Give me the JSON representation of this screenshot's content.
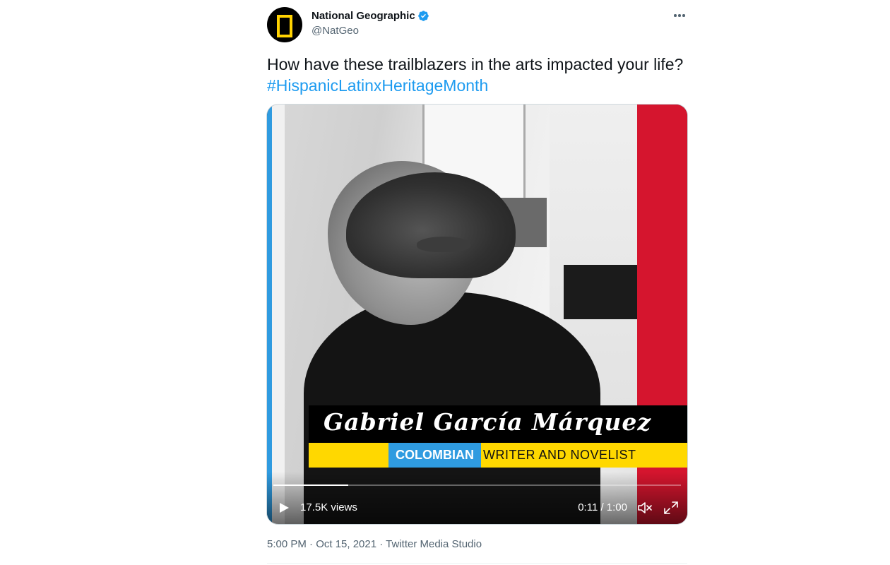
{
  "author": {
    "name": "National Geographic",
    "handle": "@NatGeo",
    "verified": true,
    "avatar_icon": "natgeo-yellow-frame-logo"
  },
  "tweet": {
    "text": "How have these trailblazers in the arts impacted your life? ",
    "hashtag": "#HispanicLatinxHeritageMonth"
  },
  "media": {
    "overlay_name": "Gabriel García Márquez",
    "overlay_nationality": "COLOMBIAN",
    "overlay_role": "WRITER AND NOVELIST",
    "views": "17.5K views",
    "time": "0:11 / 1:00",
    "progress_fraction": 0.183,
    "colors": {
      "accent_blue": "#2f9be0",
      "accent_red": "#d5152e",
      "accent_yellow": "#ffd800"
    }
  },
  "meta": {
    "timestamp": "5:00 PM · Oct 15, 2021",
    "separator": " · ",
    "source": "Twitter Media Studio"
  },
  "icons": {
    "more": "more-horizontal-icon",
    "play": "play-icon",
    "mute": "volume-muted-icon",
    "fullscreen": "fullscreen-icon",
    "verified": "verified-badge-icon"
  },
  "colors": {
    "link_blue": "#1d9bf0",
    "secondary_text": "#536471"
  }
}
